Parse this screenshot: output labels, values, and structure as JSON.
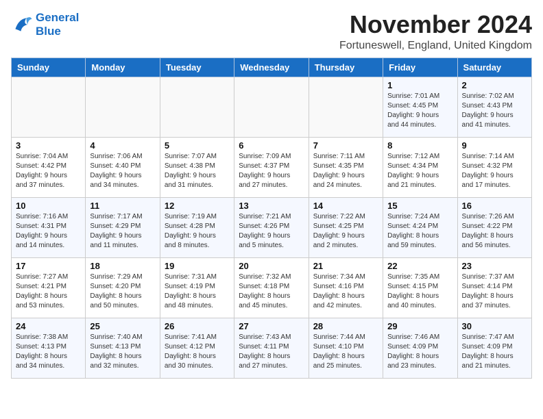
{
  "header": {
    "logo_line1": "General",
    "logo_line2": "Blue",
    "month": "November 2024",
    "location": "Fortuneswell, England, United Kingdom"
  },
  "weekdays": [
    "Sunday",
    "Monday",
    "Tuesday",
    "Wednesday",
    "Thursday",
    "Friday",
    "Saturday"
  ],
  "weeks": [
    [
      {
        "day": "",
        "info": ""
      },
      {
        "day": "",
        "info": ""
      },
      {
        "day": "",
        "info": ""
      },
      {
        "day": "",
        "info": ""
      },
      {
        "day": "",
        "info": ""
      },
      {
        "day": "1",
        "info": "Sunrise: 7:01 AM\nSunset: 4:45 PM\nDaylight: 9 hours\nand 44 minutes."
      },
      {
        "day": "2",
        "info": "Sunrise: 7:02 AM\nSunset: 4:43 PM\nDaylight: 9 hours\nand 41 minutes."
      }
    ],
    [
      {
        "day": "3",
        "info": "Sunrise: 7:04 AM\nSunset: 4:42 PM\nDaylight: 9 hours\nand 37 minutes."
      },
      {
        "day": "4",
        "info": "Sunrise: 7:06 AM\nSunset: 4:40 PM\nDaylight: 9 hours\nand 34 minutes."
      },
      {
        "day": "5",
        "info": "Sunrise: 7:07 AM\nSunset: 4:38 PM\nDaylight: 9 hours\nand 31 minutes."
      },
      {
        "day": "6",
        "info": "Sunrise: 7:09 AM\nSunset: 4:37 PM\nDaylight: 9 hours\nand 27 minutes."
      },
      {
        "day": "7",
        "info": "Sunrise: 7:11 AM\nSunset: 4:35 PM\nDaylight: 9 hours\nand 24 minutes."
      },
      {
        "day": "8",
        "info": "Sunrise: 7:12 AM\nSunset: 4:34 PM\nDaylight: 9 hours\nand 21 minutes."
      },
      {
        "day": "9",
        "info": "Sunrise: 7:14 AM\nSunset: 4:32 PM\nDaylight: 9 hours\nand 17 minutes."
      }
    ],
    [
      {
        "day": "10",
        "info": "Sunrise: 7:16 AM\nSunset: 4:31 PM\nDaylight: 9 hours\nand 14 minutes."
      },
      {
        "day": "11",
        "info": "Sunrise: 7:17 AM\nSunset: 4:29 PM\nDaylight: 9 hours\nand 11 minutes."
      },
      {
        "day": "12",
        "info": "Sunrise: 7:19 AM\nSunset: 4:28 PM\nDaylight: 9 hours\nand 8 minutes."
      },
      {
        "day": "13",
        "info": "Sunrise: 7:21 AM\nSunset: 4:26 PM\nDaylight: 9 hours\nand 5 minutes."
      },
      {
        "day": "14",
        "info": "Sunrise: 7:22 AM\nSunset: 4:25 PM\nDaylight: 9 hours\nand 2 minutes."
      },
      {
        "day": "15",
        "info": "Sunrise: 7:24 AM\nSunset: 4:24 PM\nDaylight: 8 hours\nand 59 minutes."
      },
      {
        "day": "16",
        "info": "Sunrise: 7:26 AM\nSunset: 4:22 PM\nDaylight: 8 hours\nand 56 minutes."
      }
    ],
    [
      {
        "day": "17",
        "info": "Sunrise: 7:27 AM\nSunset: 4:21 PM\nDaylight: 8 hours\nand 53 minutes."
      },
      {
        "day": "18",
        "info": "Sunrise: 7:29 AM\nSunset: 4:20 PM\nDaylight: 8 hours\nand 50 minutes."
      },
      {
        "day": "19",
        "info": "Sunrise: 7:31 AM\nSunset: 4:19 PM\nDaylight: 8 hours\nand 48 minutes."
      },
      {
        "day": "20",
        "info": "Sunrise: 7:32 AM\nSunset: 4:18 PM\nDaylight: 8 hours\nand 45 minutes."
      },
      {
        "day": "21",
        "info": "Sunrise: 7:34 AM\nSunset: 4:16 PM\nDaylight: 8 hours\nand 42 minutes."
      },
      {
        "day": "22",
        "info": "Sunrise: 7:35 AM\nSunset: 4:15 PM\nDaylight: 8 hours\nand 40 minutes."
      },
      {
        "day": "23",
        "info": "Sunrise: 7:37 AM\nSunset: 4:14 PM\nDaylight: 8 hours\nand 37 minutes."
      }
    ],
    [
      {
        "day": "24",
        "info": "Sunrise: 7:38 AM\nSunset: 4:13 PM\nDaylight: 8 hours\nand 34 minutes."
      },
      {
        "day": "25",
        "info": "Sunrise: 7:40 AM\nSunset: 4:13 PM\nDaylight: 8 hours\nand 32 minutes."
      },
      {
        "day": "26",
        "info": "Sunrise: 7:41 AM\nSunset: 4:12 PM\nDaylight: 8 hours\nand 30 minutes."
      },
      {
        "day": "27",
        "info": "Sunrise: 7:43 AM\nSunset: 4:11 PM\nDaylight: 8 hours\nand 27 minutes."
      },
      {
        "day": "28",
        "info": "Sunrise: 7:44 AM\nSunset: 4:10 PM\nDaylight: 8 hours\nand 25 minutes."
      },
      {
        "day": "29",
        "info": "Sunrise: 7:46 AM\nSunset: 4:09 PM\nDaylight: 8 hours\nand 23 minutes."
      },
      {
        "day": "30",
        "info": "Sunrise: 7:47 AM\nSunset: 4:09 PM\nDaylight: 8 hours\nand 21 minutes."
      }
    ]
  ]
}
